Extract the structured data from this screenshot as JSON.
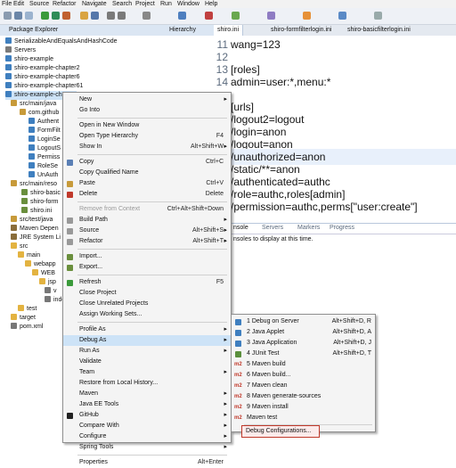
{
  "menubar": [
    "File",
    "Edit",
    "Source",
    "Refactor",
    "Navigate",
    "Search",
    "Project",
    "Run",
    "Window",
    "Help"
  ],
  "package_explorer": {
    "title": "Package Explorer",
    "tab2": "Hierarchy",
    "items": [
      "SerializableAndEqualsAndHashCode",
      "Servers",
      "shiro-example",
      "shiro-example-chapter2",
      "shiro-example-chapter6",
      "shiro-example-chapter61",
      "shiro-example-chapter7",
      "src/main/java",
      "com.github",
      "Authent",
      "FormFilt",
      "LoginSe",
      "LogoutS",
      "Permiss",
      "RoleSe",
      "UnAuth",
      "src/main/reso",
      "shiro-basic",
      "shiro-form",
      "shiro.ini",
      "src/test/java",
      "Maven Depen",
      "JRE System Li",
      "src",
      "main",
      "webapp",
      "WEB",
      "jsp",
      "v",
      "inde",
      "test",
      "target",
      "pom.xml"
    ]
  },
  "editor": {
    "tabs": [
      "shiro.ini",
      "shiro-formfilterlogin.ini",
      "shiro-basicfilterlogin.ini"
    ],
    "lines": [
      {
        "n": "11",
        "t": "wang=123"
      },
      {
        "n": "12",
        "t": ""
      },
      {
        "n": "13",
        "t": "[roles]"
      },
      {
        "n": "14",
        "t": "admin=user:*,menu:*"
      },
      {
        "n": "",
        "t": ""
      },
      {
        "n": "",
        "t": "[urls]"
      },
      {
        "n": "",
        "t": "/logout2=logout"
      },
      {
        "n": "",
        "t": "/login=anon"
      },
      {
        "n": "",
        "t": "/logout=anon"
      },
      {
        "n": "",
        "t": "/unauthorized=anon"
      },
      {
        "n": "",
        "t": "/static/**=anon"
      },
      {
        "n": "",
        "t": "/authenticated=authc"
      },
      {
        "n": "",
        "t": "/role=authc,roles[admin]"
      },
      {
        "n": "",
        "t": "/permission=authc,perms[\"user:create\"]"
      }
    ]
  },
  "console": {
    "tabs": [
      "nsole",
      "Servers",
      "Markers",
      "Progress"
    ],
    "message": "nsoles to display at this time."
  },
  "context_menu": {
    "items": [
      {
        "label": "New",
        "acc": "",
        "sub": true
      },
      {
        "label": "Go Into",
        "acc": ""
      },
      {
        "sep": true
      },
      {
        "label": "Open in New Window",
        "acc": ""
      },
      {
        "label": "Open Type Hierarchy",
        "acc": "F4"
      },
      {
        "label": "Show In",
        "acc": "Alt+Shift+W",
        "sub": true
      },
      {
        "sep": true
      },
      {
        "label": "Copy",
        "acc": "Ctrl+C"
      },
      {
        "label": "Copy Qualified Name",
        "acc": ""
      },
      {
        "label": "Paste",
        "acc": "Ctrl+V"
      },
      {
        "label": "Delete",
        "acc": "Delete"
      },
      {
        "sep": true
      },
      {
        "label": "Remove from Context",
        "acc": "Ctrl+Alt+Shift+Down",
        "disabled": true
      },
      {
        "label": "Build Path",
        "acc": "",
        "sub": true
      },
      {
        "label": "Source",
        "acc": "Alt+Shift+S",
        "sub": true
      },
      {
        "label": "Refactor",
        "acc": "Alt+Shift+T",
        "sub": true
      },
      {
        "sep": true
      },
      {
        "label": "Import...",
        "acc": ""
      },
      {
        "label": "Export...",
        "acc": ""
      },
      {
        "sep": true
      },
      {
        "label": "Refresh",
        "acc": "F5"
      },
      {
        "label": "Close Project",
        "acc": ""
      },
      {
        "label": "Close Unrelated Projects",
        "acc": ""
      },
      {
        "label": "Assign Working Sets...",
        "acc": ""
      },
      {
        "sep": true
      },
      {
        "label": "Profile As",
        "acc": "",
        "sub": true
      },
      {
        "label": "Debug As",
        "acc": "",
        "sub": true,
        "hover": true
      },
      {
        "label": "Run As",
        "acc": "",
        "sub": true
      },
      {
        "label": "Validate",
        "acc": ""
      },
      {
        "label": "Team",
        "acc": "",
        "sub": true
      },
      {
        "label": "Restore from Local History...",
        "acc": ""
      },
      {
        "label": "Maven",
        "acc": "",
        "sub": true
      },
      {
        "label": "Java EE Tools",
        "acc": "",
        "sub": true
      },
      {
        "label": "GitHub",
        "acc": "",
        "sub": true
      },
      {
        "label": "Compare With",
        "acc": "",
        "sub": true
      },
      {
        "label": "Configure",
        "acc": "",
        "sub": true
      },
      {
        "label": "Spring Tools",
        "acc": "",
        "sub": true
      },
      {
        "sep": true
      },
      {
        "label": "Properties",
        "acc": "Alt+Enter"
      }
    ]
  },
  "debug_submenu": {
    "items": [
      {
        "label": "1 Debug on Server",
        "acc": "Alt+Shift+D, R"
      },
      {
        "label": "2 Java Applet",
        "acc": "Alt+Shift+D, A"
      },
      {
        "label": "3 Java Application",
        "acc": "Alt+Shift+D, J"
      },
      {
        "label": "4 JUnit Test",
        "acc": "Alt+Shift+D, T"
      },
      {
        "label": "5 Maven build",
        "acc": "",
        "m2": true
      },
      {
        "label": "6 Maven build...",
        "acc": "",
        "m2": true
      },
      {
        "label": "7 Maven clean",
        "acc": "",
        "m2": true
      },
      {
        "label": "8 Maven generate-sources",
        "acc": "",
        "m2": true
      },
      {
        "label": "9 Maven install",
        "acc": "",
        "m2": true
      },
      {
        "label": "Maven test",
        "acc": "",
        "m2": true
      },
      {
        "sep": true
      },
      {
        "label": "Debug Configurations...",
        "acc": "",
        "selected": true
      }
    ]
  },
  "colors": {
    "accent": "#cde3f7",
    "m2": "#c0392b",
    "pkg": "#c79a3a",
    "java": "#3f7fbf",
    "folder": "#e3b341"
  }
}
